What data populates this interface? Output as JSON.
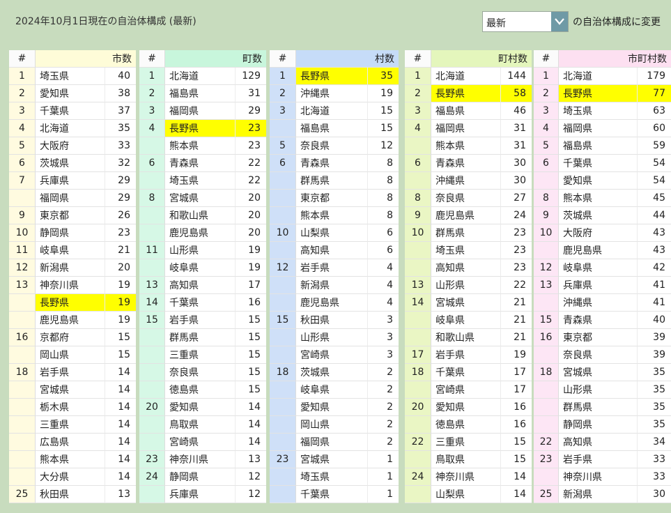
{
  "title": "2024年10月1日現在の自治体構成 (最新)",
  "selector": {
    "value": "最新",
    "suffix": "の自治体構成に変更"
  },
  "colors": {
    "highlight": "#ffff00",
    "rank_bg": [
      "#fffbe0",
      "#d6f8e6",
      "#cfe0f8",
      "#eaf6c4",
      "#fde6f5"
    ],
    "header_bg": [
      "#fefcd8",
      "#c8f6dc",
      "#c6dcf8",
      "#e4f6bc",
      "#fde0f1"
    ],
    "rank_header_bg": "#fbfbfb"
  },
  "highlight_pref": "長野県",
  "panels": [
    {
      "header": {
        "rank": "#",
        "label": "市数"
      },
      "rows": [
        {
          "rank": "1",
          "pref": "埼玉県",
          "val": "40"
        },
        {
          "rank": "2",
          "pref": "愛知県",
          "val": "38"
        },
        {
          "rank": "3",
          "pref": "千葉県",
          "val": "37"
        },
        {
          "rank": "4",
          "pref": "北海道",
          "val": "35"
        },
        {
          "rank": "5",
          "pref": "大阪府",
          "val": "33"
        },
        {
          "rank": "6",
          "pref": "茨城県",
          "val": "32"
        },
        {
          "rank": "7",
          "pref": "兵庫県",
          "val": "29"
        },
        {
          "rank": "",
          "pref": "福岡県",
          "val": "29"
        },
        {
          "rank": "9",
          "pref": "東京都",
          "val": "26"
        },
        {
          "rank": "10",
          "pref": "静岡県",
          "val": "23"
        },
        {
          "rank": "11",
          "pref": "岐阜県",
          "val": "21"
        },
        {
          "rank": "12",
          "pref": "新潟県",
          "val": "20"
        },
        {
          "rank": "13",
          "pref": "神奈川県",
          "val": "19"
        },
        {
          "rank": "",
          "pref": "長野県",
          "val": "19"
        },
        {
          "rank": "",
          "pref": "鹿児島県",
          "val": "19"
        },
        {
          "rank": "16",
          "pref": "京都府",
          "val": "15"
        },
        {
          "rank": "",
          "pref": "岡山県",
          "val": "15"
        },
        {
          "rank": "18",
          "pref": "岩手県",
          "val": "14"
        },
        {
          "rank": "",
          "pref": "宮城県",
          "val": "14"
        },
        {
          "rank": "",
          "pref": "栃木県",
          "val": "14"
        },
        {
          "rank": "",
          "pref": "三重県",
          "val": "14"
        },
        {
          "rank": "",
          "pref": "広島県",
          "val": "14"
        },
        {
          "rank": "",
          "pref": "熊本県",
          "val": "14"
        },
        {
          "rank": "",
          "pref": "大分県",
          "val": "14"
        },
        {
          "rank": "25",
          "pref": "秋田県",
          "val": "13"
        }
      ]
    },
    {
      "header": {
        "rank": "#",
        "label": "町数"
      },
      "rows": [
        {
          "rank": "1",
          "pref": "北海道",
          "val": "129"
        },
        {
          "rank": "2",
          "pref": "福島県",
          "val": "31"
        },
        {
          "rank": "3",
          "pref": "福岡県",
          "val": "29"
        },
        {
          "rank": "4",
          "pref": "長野県",
          "val": "23"
        },
        {
          "rank": "",
          "pref": "熊本県",
          "val": "23"
        },
        {
          "rank": "6",
          "pref": "青森県",
          "val": "22"
        },
        {
          "rank": "",
          "pref": "埼玉県",
          "val": "22"
        },
        {
          "rank": "8",
          "pref": "宮城県",
          "val": "20"
        },
        {
          "rank": "",
          "pref": "和歌山県",
          "val": "20"
        },
        {
          "rank": "",
          "pref": "鹿児島県",
          "val": "20"
        },
        {
          "rank": "11",
          "pref": "山形県",
          "val": "19"
        },
        {
          "rank": "",
          "pref": "岐阜県",
          "val": "19"
        },
        {
          "rank": "13",
          "pref": "高知県",
          "val": "17"
        },
        {
          "rank": "14",
          "pref": "千葉県",
          "val": "16"
        },
        {
          "rank": "15",
          "pref": "岩手県",
          "val": "15"
        },
        {
          "rank": "",
          "pref": "群馬県",
          "val": "15"
        },
        {
          "rank": "",
          "pref": "三重県",
          "val": "15"
        },
        {
          "rank": "",
          "pref": "奈良県",
          "val": "15"
        },
        {
          "rank": "",
          "pref": "徳島県",
          "val": "15"
        },
        {
          "rank": "20",
          "pref": "愛知県",
          "val": "14"
        },
        {
          "rank": "",
          "pref": "鳥取県",
          "val": "14"
        },
        {
          "rank": "",
          "pref": "宮崎県",
          "val": "14"
        },
        {
          "rank": "23",
          "pref": "神奈川県",
          "val": "13"
        },
        {
          "rank": "24",
          "pref": "静岡県",
          "val": "12"
        },
        {
          "rank": "",
          "pref": "兵庫県",
          "val": "12"
        }
      ]
    },
    {
      "header": {
        "rank": "#",
        "label": "村数"
      },
      "rows": [
        {
          "rank": "1",
          "pref": "長野県",
          "val": "35"
        },
        {
          "rank": "2",
          "pref": "沖縄県",
          "val": "19"
        },
        {
          "rank": "3",
          "pref": "北海道",
          "val": "15"
        },
        {
          "rank": "",
          "pref": "福島県",
          "val": "15"
        },
        {
          "rank": "5",
          "pref": "奈良県",
          "val": "12"
        },
        {
          "rank": "6",
          "pref": "青森県",
          "val": "8"
        },
        {
          "rank": "",
          "pref": "群馬県",
          "val": "8"
        },
        {
          "rank": "",
          "pref": "東京都",
          "val": "8"
        },
        {
          "rank": "",
          "pref": "熊本県",
          "val": "8"
        },
        {
          "rank": "10",
          "pref": "山梨県",
          "val": "6"
        },
        {
          "rank": "",
          "pref": "高知県",
          "val": "6"
        },
        {
          "rank": "12",
          "pref": "岩手県",
          "val": "4"
        },
        {
          "rank": "",
          "pref": "新潟県",
          "val": "4"
        },
        {
          "rank": "",
          "pref": "鹿児島県",
          "val": "4"
        },
        {
          "rank": "15",
          "pref": "秋田県",
          "val": "3"
        },
        {
          "rank": "",
          "pref": "山形県",
          "val": "3"
        },
        {
          "rank": "",
          "pref": "宮崎県",
          "val": "3"
        },
        {
          "rank": "18",
          "pref": "茨城県",
          "val": "2"
        },
        {
          "rank": "",
          "pref": "岐阜県",
          "val": "2"
        },
        {
          "rank": "",
          "pref": "愛知県",
          "val": "2"
        },
        {
          "rank": "",
          "pref": "岡山県",
          "val": "2"
        },
        {
          "rank": "",
          "pref": "福岡県",
          "val": "2"
        },
        {
          "rank": "23",
          "pref": "宮城県",
          "val": "1"
        },
        {
          "rank": "",
          "pref": "埼玉県",
          "val": "1"
        },
        {
          "rank": "",
          "pref": "千葉県",
          "val": "1"
        }
      ]
    },
    {
      "header": {
        "rank": "#",
        "label": "町村数"
      },
      "rows": [
        {
          "rank": "1",
          "pref": "北海道",
          "val": "144"
        },
        {
          "rank": "2",
          "pref": "長野県",
          "val": "58"
        },
        {
          "rank": "3",
          "pref": "福島県",
          "val": "46"
        },
        {
          "rank": "4",
          "pref": "福岡県",
          "val": "31"
        },
        {
          "rank": "",
          "pref": "熊本県",
          "val": "31"
        },
        {
          "rank": "6",
          "pref": "青森県",
          "val": "30"
        },
        {
          "rank": "",
          "pref": "沖縄県",
          "val": "30"
        },
        {
          "rank": "8",
          "pref": "奈良県",
          "val": "27"
        },
        {
          "rank": "9",
          "pref": "鹿児島県",
          "val": "24"
        },
        {
          "rank": "10",
          "pref": "群馬県",
          "val": "23"
        },
        {
          "rank": "",
          "pref": "埼玉県",
          "val": "23"
        },
        {
          "rank": "",
          "pref": "高知県",
          "val": "23"
        },
        {
          "rank": "13",
          "pref": "山形県",
          "val": "22"
        },
        {
          "rank": "14",
          "pref": "宮城県",
          "val": "21"
        },
        {
          "rank": "",
          "pref": "岐阜県",
          "val": "21"
        },
        {
          "rank": "",
          "pref": "和歌山県",
          "val": "21"
        },
        {
          "rank": "17",
          "pref": "岩手県",
          "val": "19"
        },
        {
          "rank": "18",
          "pref": "千葉県",
          "val": "17"
        },
        {
          "rank": "",
          "pref": "宮崎県",
          "val": "17"
        },
        {
          "rank": "20",
          "pref": "愛知県",
          "val": "16"
        },
        {
          "rank": "",
          "pref": "徳島県",
          "val": "16"
        },
        {
          "rank": "22",
          "pref": "三重県",
          "val": "15"
        },
        {
          "rank": "",
          "pref": "鳥取県",
          "val": "15"
        },
        {
          "rank": "24",
          "pref": "神奈川県",
          "val": "14"
        },
        {
          "rank": "",
          "pref": "山梨県",
          "val": "14"
        }
      ]
    },
    {
      "header": {
        "rank": "#",
        "label": "市町村数"
      },
      "rows": [
        {
          "rank": "1",
          "pref": "北海道",
          "val": "179"
        },
        {
          "rank": "2",
          "pref": "長野県",
          "val": "77"
        },
        {
          "rank": "3",
          "pref": "埼玉県",
          "val": "63"
        },
        {
          "rank": "4",
          "pref": "福岡県",
          "val": "60"
        },
        {
          "rank": "5",
          "pref": "福島県",
          "val": "59"
        },
        {
          "rank": "6",
          "pref": "千葉県",
          "val": "54"
        },
        {
          "rank": "",
          "pref": "愛知県",
          "val": "54"
        },
        {
          "rank": "8",
          "pref": "熊本県",
          "val": "45"
        },
        {
          "rank": "9",
          "pref": "茨城県",
          "val": "44"
        },
        {
          "rank": "10",
          "pref": "大阪府",
          "val": "43"
        },
        {
          "rank": "",
          "pref": "鹿児島県",
          "val": "43"
        },
        {
          "rank": "12",
          "pref": "岐阜県",
          "val": "42"
        },
        {
          "rank": "13",
          "pref": "兵庫県",
          "val": "41"
        },
        {
          "rank": "",
          "pref": "沖縄県",
          "val": "41"
        },
        {
          "rank": "15",
          "pref": "青森県",
          "val": "40"
        },
        {
          "rank": "16",
          "pref": "東京都",
          "val": "39"
        },
        {
          "rank": "",
          "pref": "奈良県",
          "val": "39"
        },
        {
          "rank": "18",
          "pref": "宮城県",
          "val": "35"
        },
        {
          "rank": "",
          "pref": "山形県",
          "val": "35"
        },
        {
          "rank": "",
          "pref": "群馬県",
          "val": "35"
        },
        {
          "rank": "",
          "pref": "静岡県",
          "val": "35"
        },
        {
          "rank": "22",
          "pref": "高知県",
          "val": "34"
        },
        {
          "rank": "23",
          "pref": "岩手県",
          "val": "33"
        },
        {
          "rank": "",
          "pref": "神奈川県",
          "val": "33"
        },
        {
          "rank": "25",
          "pref": "新潟県",
          "val": "30"
        }
      ]
    }
  ]
}
